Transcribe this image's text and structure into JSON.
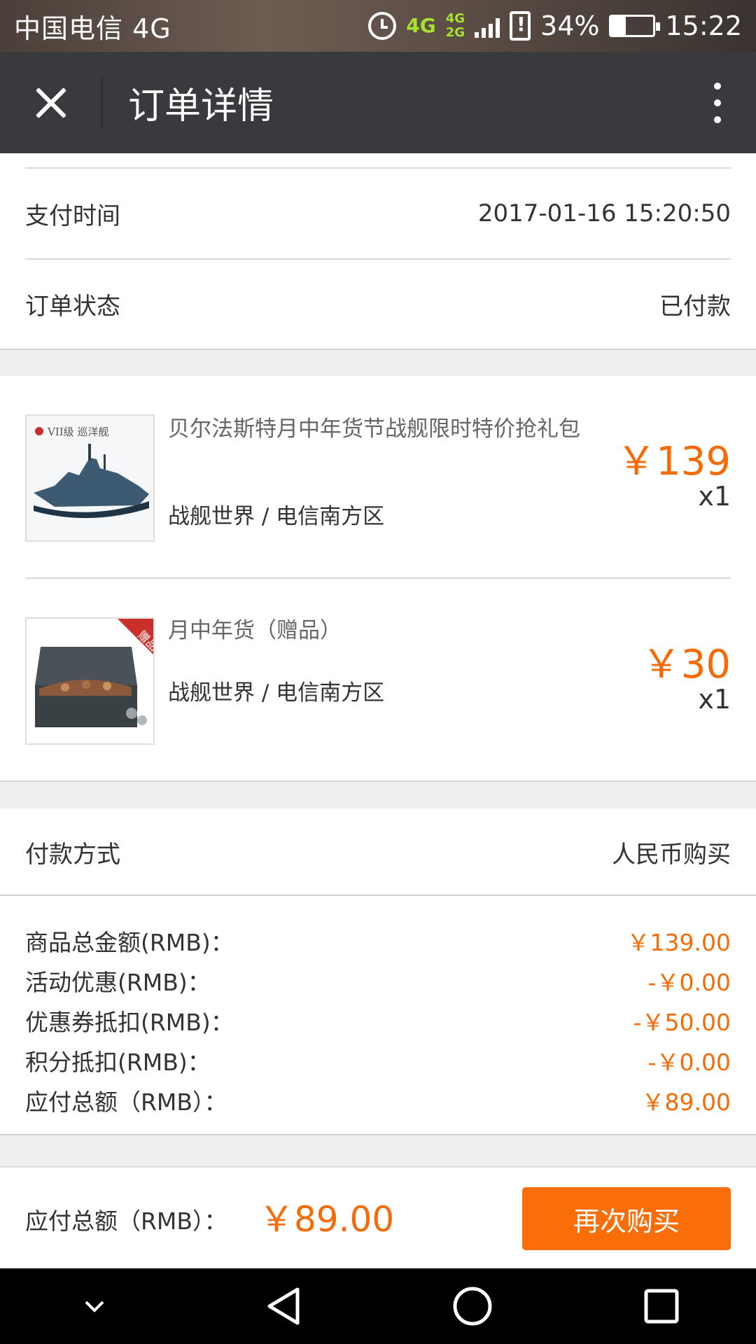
{
  "status_bar": {
    "carrier": "中国电信 4G",
    "network_4g": "4G",
    "network_4g2g_top": "4G",
    "network_4g2g_bottom": "2G",
    "battery": "34%",
    "time": "15:22"
  },
  "header": {
    "title": "订单详情"
  },
  "order_info": {
    "pay_time_label": "支付时间",
    "pay_time_value": "2017-01-16 15:20:50",
    "status_label": "订单状态",
    "status_value": "已付款"
  },
  "products": [
    {
      "name": "贝尔法斯特月中年货节战舰限时特价抢礼包",
      "badge": "VII级 巡洋舰",
      "game": "战舰世界 / 电信南方区",
      "price": "￥139",
      "qty": "x1"
    },
    {
      "name": "月中年货（赠品）",
      "badge": "赠品",
      "game": "战舰世界 / 电信南方区",
      "price": "￥30",
      "qty": "x1"
    }
  ],
  "payment": {
    "method_label": "付款方式",
    "method_value": "人民币购买"
  },
  "summary": [
    {
      "label": "商品总金额(RMB)：",
      "value": "￥139.00"
    },
    {
      "label": "活动优惠(RMB)：",
      "value": "-￥0.00"
    },
    {
      "label": "优惠券抵扣(RMB)：",
      "value": "-￥50.00"
    },
    {
      "label": "积分抵扣(RMB)：",
      "value": "-￥0.00"
    },
    {
      "label": "应付总额（RMB）：",
      "value": "￥89.00"
    }
  ],
  "bottom": {
    "total_label": "应付总额（RMB）：",
    "total_value": "￥89.00",
    "buy_again": "再次购买"
  },
  "colors": {
    "accent": "#f76b07",
    "header_bg": "#393a3e",
    "button_bg": "#fa6e0a"
  },
  "icons": [
    "close-icon",
    "more-icon",
    "back-icon",
    "home-icon",
    "recents-icon",
    "nav-down-icon"
  ]
}
